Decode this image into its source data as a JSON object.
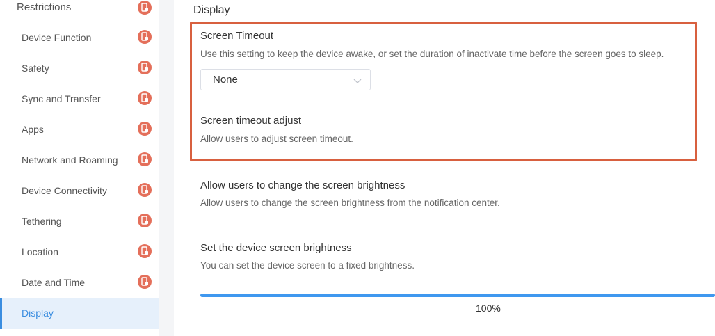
{
  "sidebar": {
    "header": "Restrictions",
    "items": [
      {
        "label": "Device Function"
      },
      {
        "label": "Safety"
      },
      {
        "label": "Sync and Transfer"
      },
      {
        "label": "Apps"
      },
      {
        "label": "Network and Roaming"
      },
      {
        "label": "Device Connectivity"
      },
      {
        "label": "Tethering"
      },
      {
        "label": "Location"
      },
      {
        "label": "Date and Time"
      },
      {
        "label": "Display"
      }
    ],
    "active_item": "Display",
    "badge_icon": "phone-lock-icon",
    "badge_color": "#e46f5a",
    "accent_color": "#3a8de0"
  },
  "main": {
    "section_title": "Display",
    "screen_timeout": {
      "title": "Screen Timeout",
      "description": "Use this setting to keep the device awake, or set the duration of inactivate time before the screen goes to sleep.",
      "selected_value": "None"
    },
    "screen_timeout_adjust": {
      "title": "Screen timeout adjust",
      "description": "Allow users to adjust screen timeout."
    },
    "brightness_change": {
      "title": "Allow users to change the screen brightness",
      "description": "Allow users to change the screen brightness from the notification center."
    },
    "device_brightness": {
      "title": "Set the device screen brightness",
      "description": "You can set the device screen to a fixed brightness.",
      "value_percent": 100,
      "value_label": "100%"
    },
    "highlight_color": "#d8603f"
  }
}
